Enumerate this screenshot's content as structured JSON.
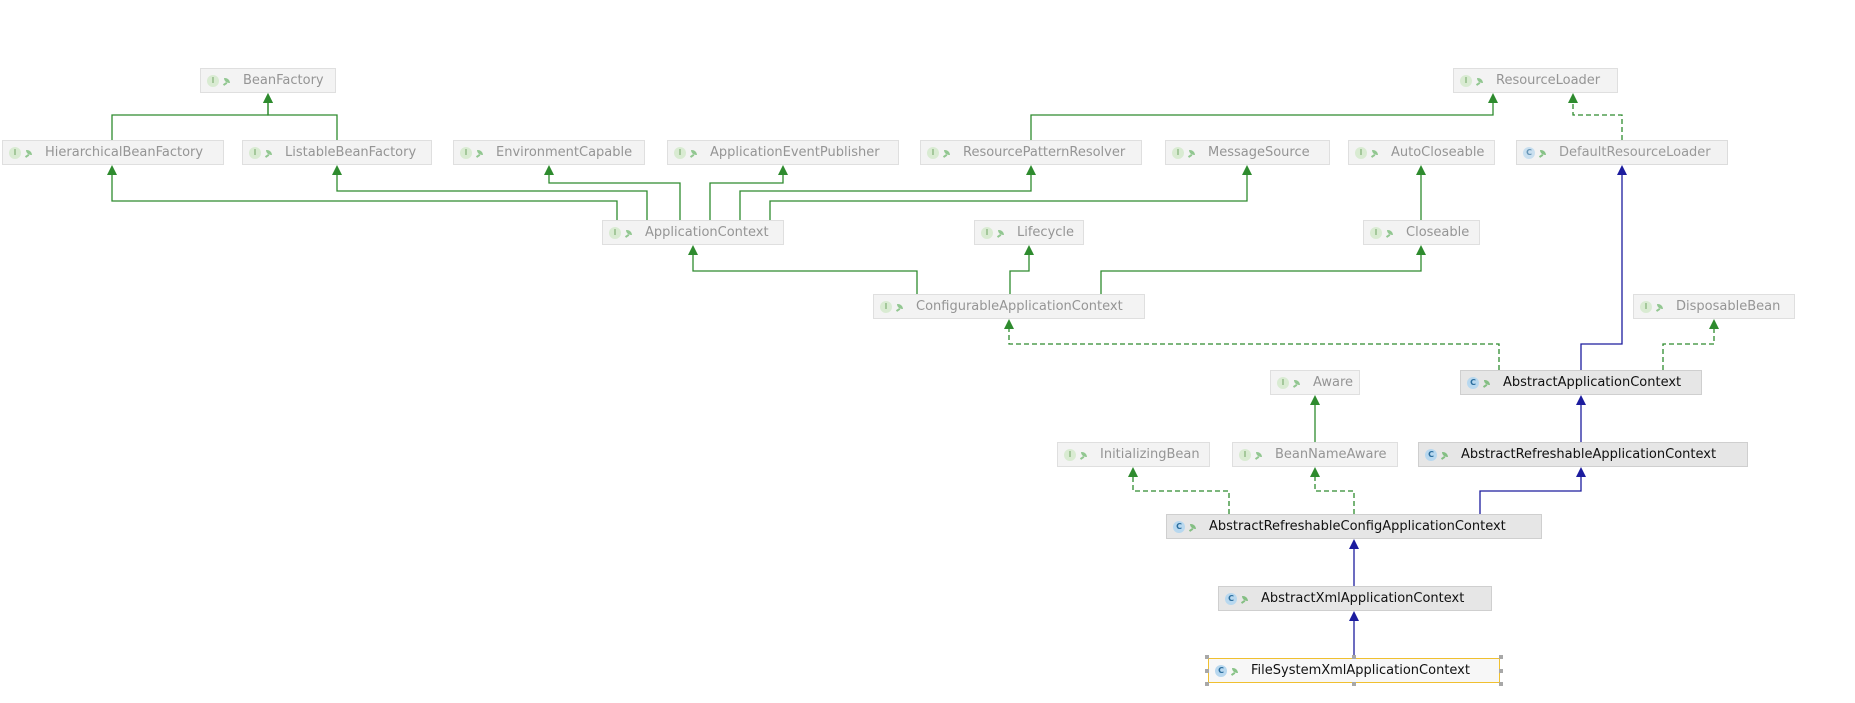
{
  "legend": {
    "interface_glyph": "I",
    "class_glyph": "C"
  },
  "colors": {
    "interface_edge": "#2e8b2e",
    "class_edge": "#1c1c9e",
    "selection_border": "#f0c030"
  },
  "nodes": [
    {
      "id": "beanfactory",
      "label": "BeanFactory",
      "kind": "interface"
    },
    {
      "id": "resourceloader",
      "label": "ResourceLoader",
      "kind": "interface"
    },
    {
      "id": "hierarchicalbeanfactory",
      "label": "HierarchicalBeanFactory",
      "kind": "interface"
    },
    {
      "id": "listablebeanfactory",
      "label": "ListableBeanFactory",
      "kind": "interface"
    },
    {
      "id": "environmentcapable",
      "label": "EnvironmentCapable",
      "kind": "interface"
    },
    {
      "id": "applicationeventpublisher",
      "label": "ApplicationEventPublisher",
      "kind": "interface"
    },
    {
      "id": "resourcepatternresolver",
      "label": "ResourcePatternResolver",
      "kind": "interface"
    },
    {
      "id": "messagesource",
      "label": "MessageSource",
      "kind": "interface"
    },
    {
      "id": "autocloseable",
      "label": "AutoCloseable",
      "kind": "interface"
    },
    {
      "id": "defaultresourceloader",
      "label": "DefaultResourceLoader",
      "kind": "class",
      "faded": true
    },
    {
      "id": "applicationcontext",
      "label": "ApplicationContext",
      "kind": "interface"
    },
    {
      "id": "lifecycle",
      "label": "Lifecycle",
      "kind": "interface"
    },
    {
      "id": "closeable",
      "label": "Closeable",
      "kind": "interface"
    },
    {
      "id": "configurableapplicationcontext",
      "label": "ConfigurableApplicationContext",
      "kind": "interface"
    },
    {
      "id": "disposablebean",
      "label": "DisposableBean",
      "kind": "interface"
    },
    {
      "id": "aware",
      "label": "Aware",
      "kind": "interface"
    },
    {
      "id": "abstractapplicationcontext",
      "label": "AbstractApplicationContext",
      "kind": "class"
    },
    {
      "id": "initializingbean",
      "label": "InitializingBean",
      "kind": "interface"
    },
    {
      "id": "beannameaware",
      "label": "BeanNameAware",
      "kind": "interface"
    },
    {
      "id": "abstractrefreshableapplicationcontext",
      "label": "AbstractRefreshableApplicationContext",
      "kind": "class"
    },
    {
      "id": "abstractrefreshableconfigapplicationcontext",
      "label": "AbstractRefreshableConfigApplicationContext",
      "kind": "class"
    },
    {
      "id": "abstractxmlapplicationcontext",
      "label": "AbstractXmlApplicationContext",
      "kind": "class"
    },
    {
      "id": "filesystemxmlapplicationcontext",
      "label": "FileSystemXmlApplicationContext",
      "kind": "class",
      "selected": true
    }
  ],
  "edges": [
    {
      "from": "hierarchicalbeanfactory",
      "to": "beanfactory",
      "type": "extends-interface"
    },
    {
      "from": "listablebeanfactory",
      "to": "beanfactory",
      "type": "extends-interface"
    },
    {
      "from": "resourcepatternresolver",
      "to": "resourceloader",
      "type": "extends-interface"
    },
    {
      "from": "defaultresourceloader",
      "to": "resourceloader",
      "type": "implements"
    },
    {
      "from": "applicationcontext",
      "to": "hierarchicalbeanfactory",
      "type": "extends-interface"
    },
    {
      "from": "applicationcontext",
      "to": "listablebeanfactory",
      "type": "extends-interface"
    },
    {
      "from": "applicationcontext",
      "to": "environmentcapable",
      "type": "extends-interface"
    },
    {
      "from": "applicationcontext",
      "to": "applicationeventpublisher",
      "type": "extends-interface"
    },
    {
      "from": "applicationcontext",
      "to": "resourcepatternresolver",
      "type": "extends-interface"
    },
    {
      "from": "applicationcontext",
      "to": "messagesource",
      "type": "extends-interface"
    },
    {
      "from": "closeable",
      "to": "autocloseable",
      "type": "extends-interface"
    },
    {
      "from": "configurableapplicationcontext",
      "to": "applicationcontext",
      "type": "extends-interface"
    },
    {
      "from": "configurableapplicationcontext",
      "to": "lifecycle",
      "type": "extends-interface"
    },
    {
      "from": "configurableapplicationcontext",
      "to": "closeable",
      "type": "extends-interface"
    },
    {
      "from": "abstractapplicationcontext",
      "to": "configurableapplicationcontext",
      "type": "implements"
    },
    {
      "from": "abstractapplicationcontext",
      "to": "defaultresourceloader",
      "type": "extends-class"
    },
    {
      "from": "abstractapplicationcontext",
      "to": "disposablebean",
      "type": "implements"
    },
    {
      "from": "beannameaware",
      "to": "aware",
      "type": "extends-interface"
    },
    {
      "from": "abstractrefreshableapplicationcontext",
      "to": "abstractapplicationcontext",
      "type": "extends-class"
    },
    {
      "from": "abstractrefreshableconfigapplicationcontext",
      "to": "initializingbean",
      "type": "implements"
    },
    {
      "from": "abstractrefreshableconfigapplicationcontext",
      "to": "beannameaware",
      "type": "implements"
    },
    {
      "from": "abstractrefreshableconfigapplicationcontext",
      "to": "abstractrefreshableapplicationcontext",
      "type": "extends-class"
    },
    {
      "from": "abstractxmlapplicationcontext",
      "to": "abstractrefreshableconfigapplicationcontext",
      "type": "extends-class"
    },
    {
      "from": "filesystemxmlapplicationcontext",
      "to": "abstractxmlapplicationcontext",
      "type": "extends-class"
    }
  ]
}
